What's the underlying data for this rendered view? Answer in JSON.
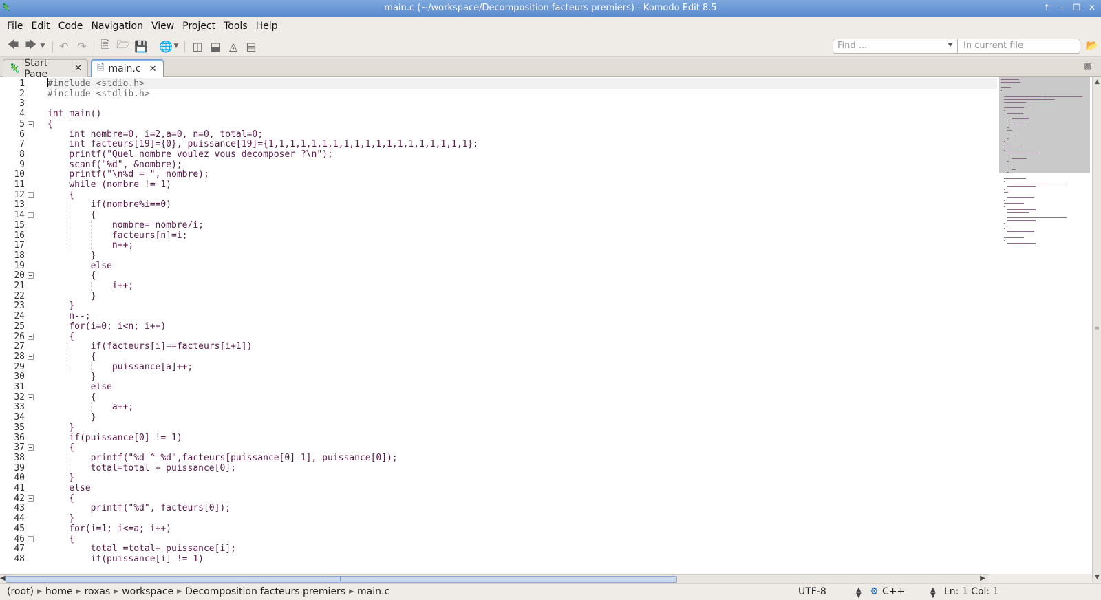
{
  "window": {
    "title": "main.c (~/workspace/Decomposition facteurs premiers) - Komodo Edit 8.5"
  },
  "menu": [
    {
      "label": "File",
      "key": "F",
      "rest": "ile"
    },
    {
      "label": "Edit",
      "key": "E",
      "rest": "dit"
    },
    {
      "label": "Code",
      "key": "C",
      "rest": "ode"
    },
    {
      "label": "Navigation",
      "key": "N",
      "rest": "avigation"
    },
    {
      "label": "View",
      "key": "V",
      "rest": "iew"
    },
    {
      "label": "Project",
      "key": "P",
      "rest": "roject"
    },
    {
      "label": "Tools",
      "key": "T",
      "rest": "ools"
    },
    {
      "label": "Help",
      "key": "H",
      "rest": "elp"
    }
  ],
  "toolbar": {
    "find_placeholder": "Find ...",
    "scope_placeholder": "In current file",
    "icons": [
      "back-arrow-icon",
      "forward-arrow-icon",
      "undo-icon",
      "redo-icon",
      "new-file-icon",
      "open-folder-icon",
      "save-icon",
      "globe-icon",
      "left-pane-icon",
      "bottom-pane-icon",
      "right-pane-icon",
      "toolbox-icon"
    ]
  },
  "tabs": [
    {
      "label": "Start Page",
      "active": false
    },
    {
      "label": "main.c",
      "active": true
    }
  ],
  "editor": {
    "lines": [
      "#include <stdio.h>",
      "#include <stdlib.h>",
      "",
      "int main()",
      "{",
      "    int nombre=0, i=2,a=0, n=0, total=0;",
      "    int facteurs[19]={0}, puissance[19]={1,1,1,1,1,1,1,1,1,1,1,1,1,1,1,1,1,1,1};",
      "    printf(\"Quel nombre voulez vous decomposer ?\\n\");",
      "    scanf(\"%d\", &nombre);",
      "    printf(\"\\n%d = \", nombre);",
      "    while (nombre != 1)",
      "    {",
      "        if(nombre%i==0)",
      "        {",
      "            nombre= nombre/i;",
      "            facteurs[n]=i;",
      "            n++;",
      "        }",
      "        else",
      "        {",
      "            i++;",
      "        }",
      "    }",
      "    n--;",
      "    for(i=0; i<n; i++)",
      "    {",
      "        if(facteurs[i]==facteurs[i+1])",
      "        {",
      "            puissance[a]++;",
      "        }",
      "        else",
      "        {",
      "            a++;",
      "        }",
      "    }",
      "    if(puissance[0] != 1)",
      "    {",
      "        printf(\"%d ^ %d\",facteurs[puissance[0]-1], puissance[0]);",
      "        total=total + puissance[0];",
      "    }",
      "    else",
      "    {",
      "        printf(\"%d\", facteurs[0]);",
      "    }",
      "    for(i=1; i<=a; i++)",
      "    {",
      "        total =total+ puissance[i];",
      "        if(puissance[i] != 1)"
    ],
    "fold_lines": [
      5,
      12,
      14,
      20,
      26,
      28,
      32,
      37,
      42,
      46
    ]
  },
  "status": {
    "breadcrumbs": [
      "(root)",
      "home",
      "roxas",
      "workspace",
      "Decomposition facteurs premiers",
      "main.c"
    ],
    "encoding": "UTF-8",
    "language": "C++",
    "position": "Ln: 1 Col: 1"
  },
  "colors": {
    "titlebar": "#5b8bd0",
    "code_text": "#5a1a4a",
    "preprocessor": "#666666"
  }
}
